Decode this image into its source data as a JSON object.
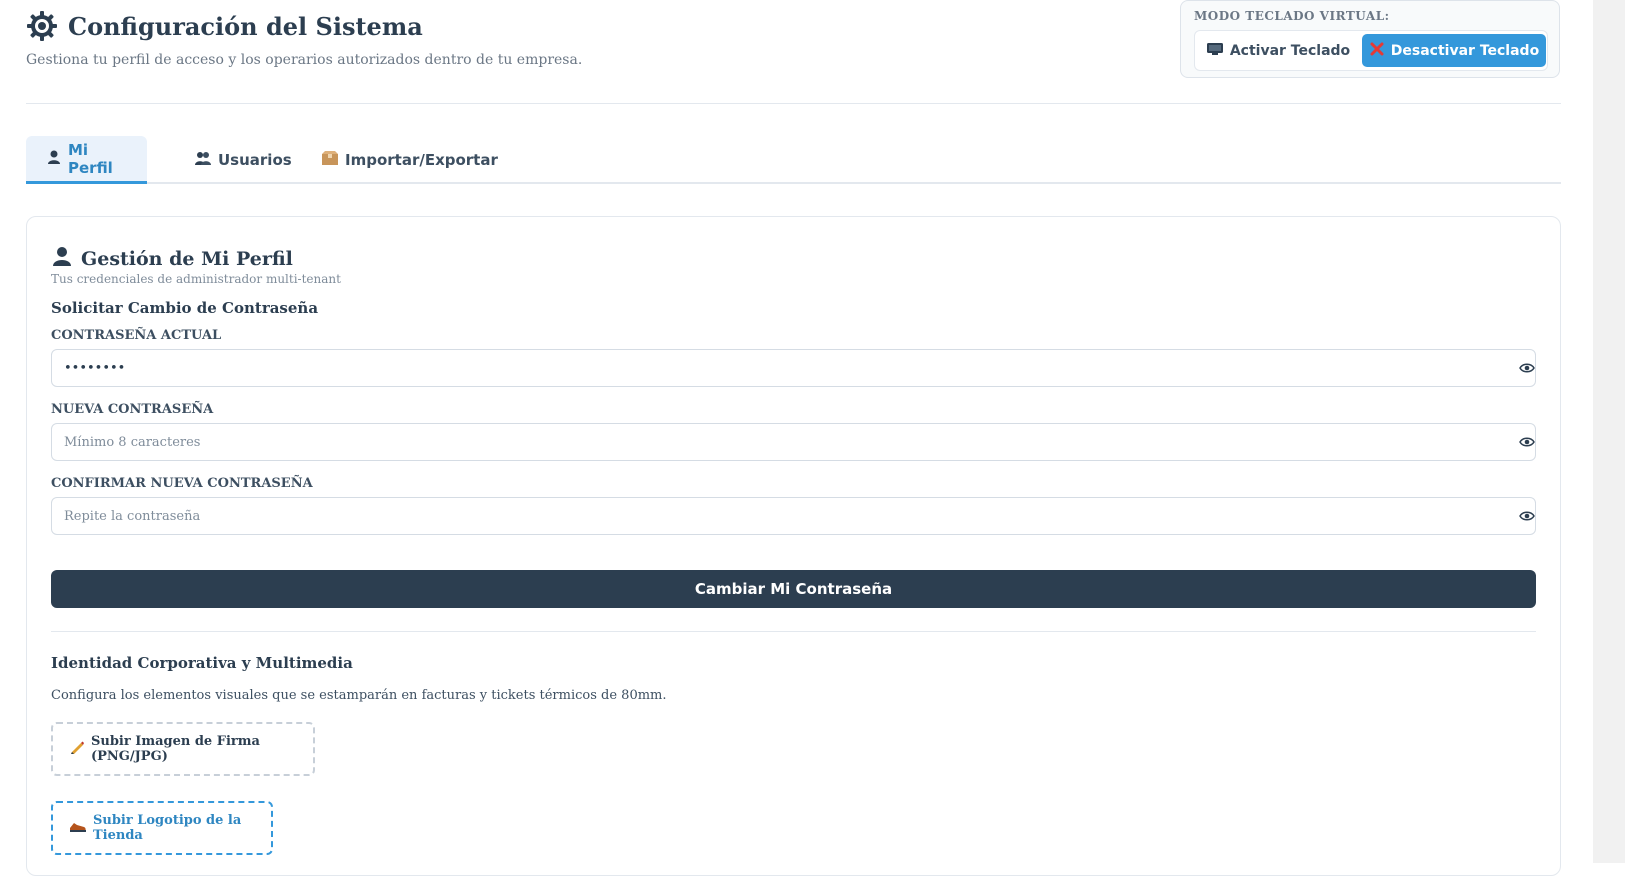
{
  "header": {
    "title": "Configuración del Sistema",
    "subtitle": "Gestiona tu perfil de acceso y los operarios autorizados dentro de tu empresa.",
    "icon": "gear-icon"
  },
  "keyboard_mode": {
    "label": "MODO TECLADO VIRTUAL:",
    "activate_label": "Activar Teclado",
    "deactivate_label": "Desactivar Teclado",
    "activate_icon": "keyboard-icon",
    "deactivate_icon": "cross-icon",
    "active_color": "#3498db"
  },
  "tabs": [
    {
      "label": "Mi Perfil",
      "icon": "user-icon",
      "active": true
    },
    {
      "label": "Usuarios",
      "icon": "users-icon",
      "active": false
    },
    {
      "label": "Importar/Exportar",
      "icon": "box-icon",
      "active": false
    }
  ],
  "profile": {
    "title": "Gestión de Mi Perfil",
    "subtitle": "Tus credenciales de administrador multi-tenant",
    "password_section": {
      "title": "Solicitar Cambio de Contraseña",
      "current_label": "CONTRASEÑA ACTUAL",
      "current_value": "••••••••",
      "new_label": "NUEVA CONTRASEÑA",
      "new_placeholder": "Mínimo 8 caracteres",
      "confirm_label": "CONFIRMAR NUEVA CONTRASEÑA",
      "confirm_placeholder": "Repite la contraseña",
      "submit_label": "Cambiar Mi Contraseña"
    },
    "identity_section": {
      "title": "Identidad Corporativa y Multimedia",
      "description": "Configura los elementos visuales que se estamparán en facturas y tickets térmicos de 80mm.",
      "signature_label": "Subir Imagen de Firma (PNG/JPG)",
      "logo_label": "Subir Logotipo de la Tienda"
    }
  },
  "colors": {
    "primary": "#2c3e50",
    "accent": "#3498db"
  }
}
